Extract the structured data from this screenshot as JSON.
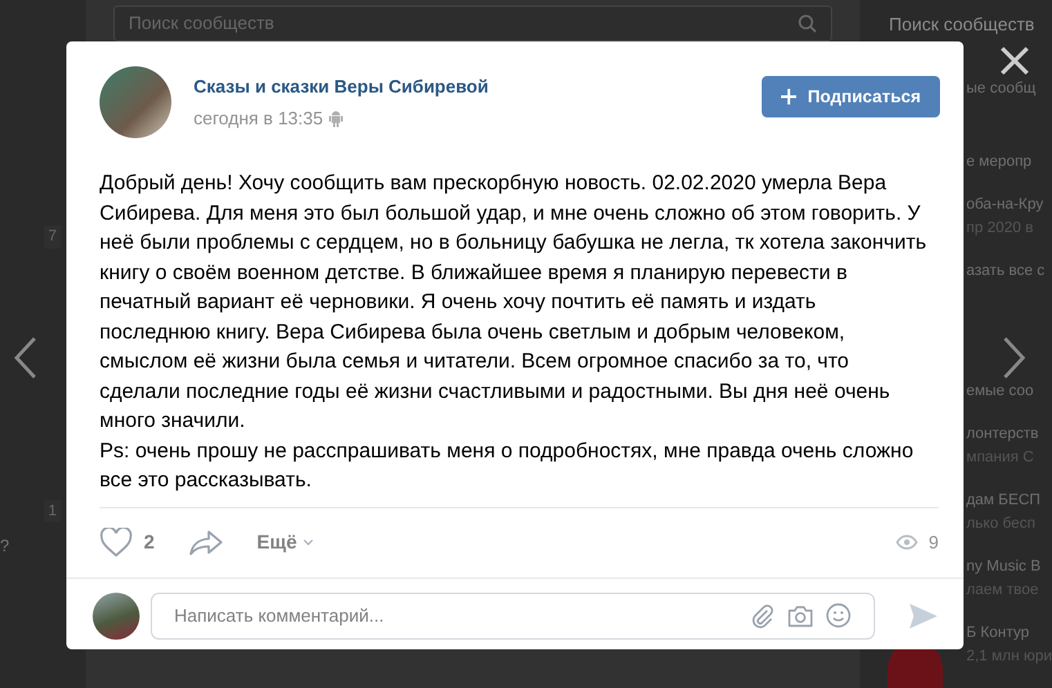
{
  "background": {
    "feed_search": {
      "placeholder": "Поиск сообществ"
    },
    "right_search": "Поиск сообществ",
    "left_badges": [
      "7",
      "1"
    ],
    "left_fragment": "?",
    "right_sections": [
      [
        [
          "ые сообщ"
        ]
      ],
      [
        [
          "е меропр"
        ],
        [
          "оба-на-Кру",
          "пр 2020 в"
        ],
        [
          "азать все с"
        ]
      ],
      [
        [
          "емые соо"
        ],
        [
          "лонтерств",
          "мпания С"
        ],
        [
          "дам БЕСП",
          "лько бесп"
        ],
        [
          "ny Music B",
          "лаем твое"
        ],
        [
          "Б Контур",
          "2,1 млн юри"
        ]
      ]
    ]
  },
  "post": {
    "author": "Сказы и сказки Веры Сибиревой",
    "time": "сегодня в 13:35",
    "subscribe": "Подписаться",
    "paragraphs": [
      "Добрый день! Хочу сообщить вам прескорбную новость. 02.02.2020 умерла Вера Сибирева. Для меня это был большой удар, и мне очень сложно об этом говорить. У неё были проблемы с сердцем, но в больницу бабушка не легла, тк хотела закончить книгу о своём военном детстве. В ближайшее время я планирую перевести в печатный вариант её черновики. Я очень хочу почтить её память и издать последнюю книгу. Вера Сибирева была очень светлым и добрым человеком, смыслом её жизни была семья и читатели. Всем огромное спасибо за то, что сделали последние годы её жизни счастливыми и радостными. Вы дня неё очень много значили.",
      "Ps: очень прошу не расспрашивать меня о подробностях, мне правда очень сложно все это рассказывать."
    ],
    "likes": {
      "count": "2",
      "liked": false
    },
    "more": "Ещё",
    "views": "9"
  },
  "comment": {
    "placeholder": "Написать комментарий..."
  }
}
